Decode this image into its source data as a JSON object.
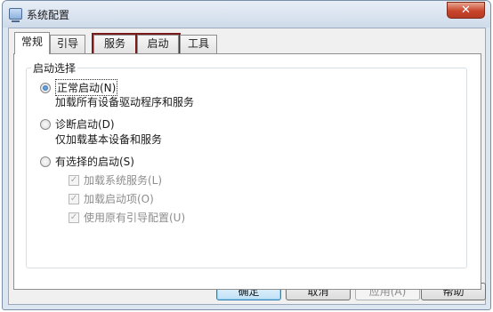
{
  "window": {
    "title": "系统配置",
    "close_glyph": "✕"
  },
  "tabs": [
    {
      "label": "常规",
      "active": true
    },
    {
      "label": "引导",
      "active": false
    },
    {
      "label": "服务",
      "active": false,
      "highlighted": true
    },
    {
      "label": "启动",
      "active": false,
      "highlighted": true
    },
    {
      "label": "工具",
      "active": false
    }
  ],
  "startup": {
    "group_title": "启动选择",
    "normal": {
      "label": "正常启动(N)",
      "desc": "加载所有设备驱动程序和服务",
      "selected": true
    },
    "diagnostic": {
      "label": "诊断启动(D)",
      "desc": "仅加载基本设备和服务",
      "selected": false
    },
    "selective": {
      "label": "有选择的启动(S)",
      "selected": false,
      "items": [
        {
          "label": "加载系统服务(L)",
          "checked": true
        },
        {
          "label": "加载启动项(O)",
          "checked": true
        },
        {
          "label": "使用原有引导配置(U)",
          "checked": true
        }
      ]
    }
  },
  "buttons": {
    "ok": "确定",
    "cancel": "取消",
    "apply": "应用(A)",
    "help": "帮助"
  },
  "colors": {
    "highlight_outline": "#7b1a1a",
    "close_button": "#c9452b"
  }
}
